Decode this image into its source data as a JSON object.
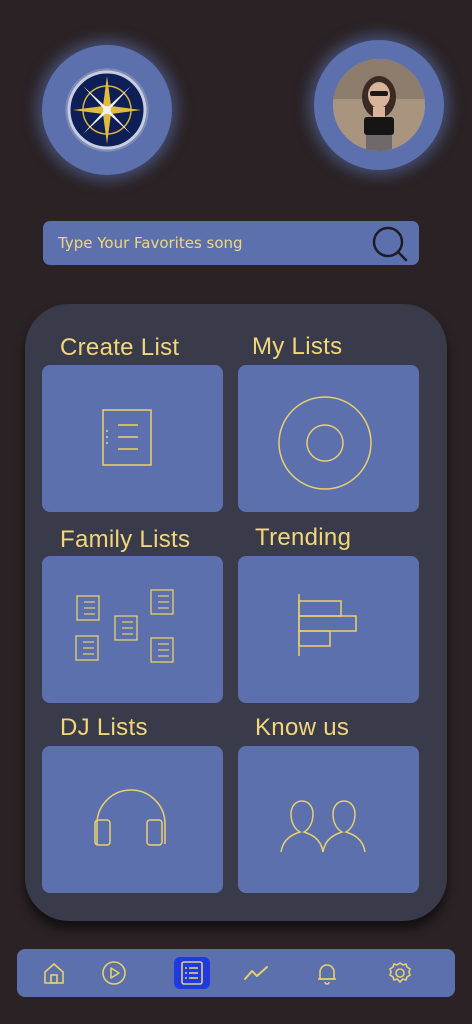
{
  "header": {
    "logo_icon": "compass-logo-icon",
    "user_avatar": "user-profile-photo"
  },
  "search": {
    "placeholder": "Type Your Favorites song",
    "icon": "search-icon"
  },
  "tiles": [
    {
      "label": "Create List",
      "icon": "list-document-icon"
    },
    {
      "label": "My Lists",
      "icon": "disc-icon"
    },
    {
      "label": "Family Lists",
      "icon": "multiple-lists-icon"
    },
    {
      "label": "Trending",
      "icon": "bar-chart-icon"
    },
    {
      "label": "DJ  Lists",
      "icon": "headphones-icon"
    },
    {
      "label": "Know us",
      "icon": "people-icon"
    }
  ],
  "bottom_nav": {
    "items": [
      {
        "name": "home",
        "icon": "home-icon"
      },
      {
        "name": "play",
        "icon": "play-icon"
      },
      {
        "name": "lists",
        "icon": "list-icon",
        "active": true
      },
      {
        "name": "trending",
        "icon": "trend-icon"
      },
      {
        "name": "notifications",
        "icon": "bell-icon"
      },
      {
        "name": "settings",
        "icon": "gear-icon"
      }
    ]
  },
  "colors": {
    "background": "#2a2224",
    "accent_blue": "#5b70ad",
    "panel": "#3a3b4a",
    "label_yellow": "#f2d77a",
    "active_nav": "#1f3be0"
  }
}
